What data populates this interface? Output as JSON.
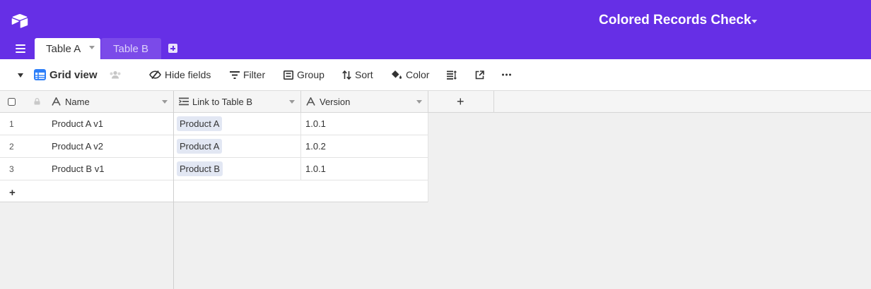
{
  "app": {
    "base_title": "Colored Records Check",
    "logo_icon": "airtable-logo-icon",
    "colors": {
      "topbar": "#662fe6",
      "inactive_tab": "#7b4ae9",
      "link_pill": "#e2e7f3",
      "grid_view_icon": "#2d7ff9"
    }
  },
  "tabs": [
    {
      "label": "Table A",
      "active": true
    },
    {
      "label": "Table B",
      "active": false
    }
  ],
  "toolbar": {
    "view_name": "Grid view",
    "hide_fields": "Hide fields",
    "filter": "Filter",
    "group": "Group",
    "sort": "Sort",
    "color": "Color",
    "more_icon": "ellipsis-icon"
  },
  "columns": [
    {
      "name": "Name",
      "type_icon": "text-icon"
    },
    {
      "name": "Link to Table B",
      "type_icon": "link-record-icon"
    },
    {
      "name": "Version",
      "type_icon": "text-icon"
    }
  ],
  "add_column_label": "+",
  "add_row_label": "+",
  "rows": [
    {
      "num": "1",
      "name": "Product A v1",
      "link": "Product A",
      "version": "1.0.1"
    },
    {
      "num": "2",
      "name": "Product A v2",
      "link": "Product A",
      "version": "1.0.2"
    },
    {
      "num": "3",
      "name": "Product B v1",
      "link": "Product B",
      "version": "1.0.1"
    }
  ]
}
